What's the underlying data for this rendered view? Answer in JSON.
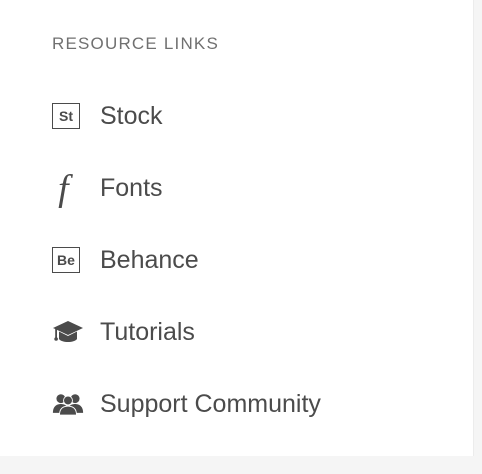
{
  "section": {
    "heading": "RESOURCE LINKS"
  },
  "links": [
    {
      "label": "Stock",
      "icon": "stock-icon",
      "icon_text": "St"
    },
    {
      "label": "Fonts",
      "icon": "fonts-icon",
      "icon_text": "f"
    },
    {
      "label": "Behance",
      "icon": "behance-icon",
      "icon_text": "Be"
    },
    {
      "label": "Tutorials",
      "icon": "graduation-cap-icon"
    },
    {
      "label": "Support Community",
      "icon": "people-icon"
    }
  ],
  "colors": {
    "text": "#4b4b4b",
    "heading": "#707070",
    "background": "#ffffff"
  }
}
